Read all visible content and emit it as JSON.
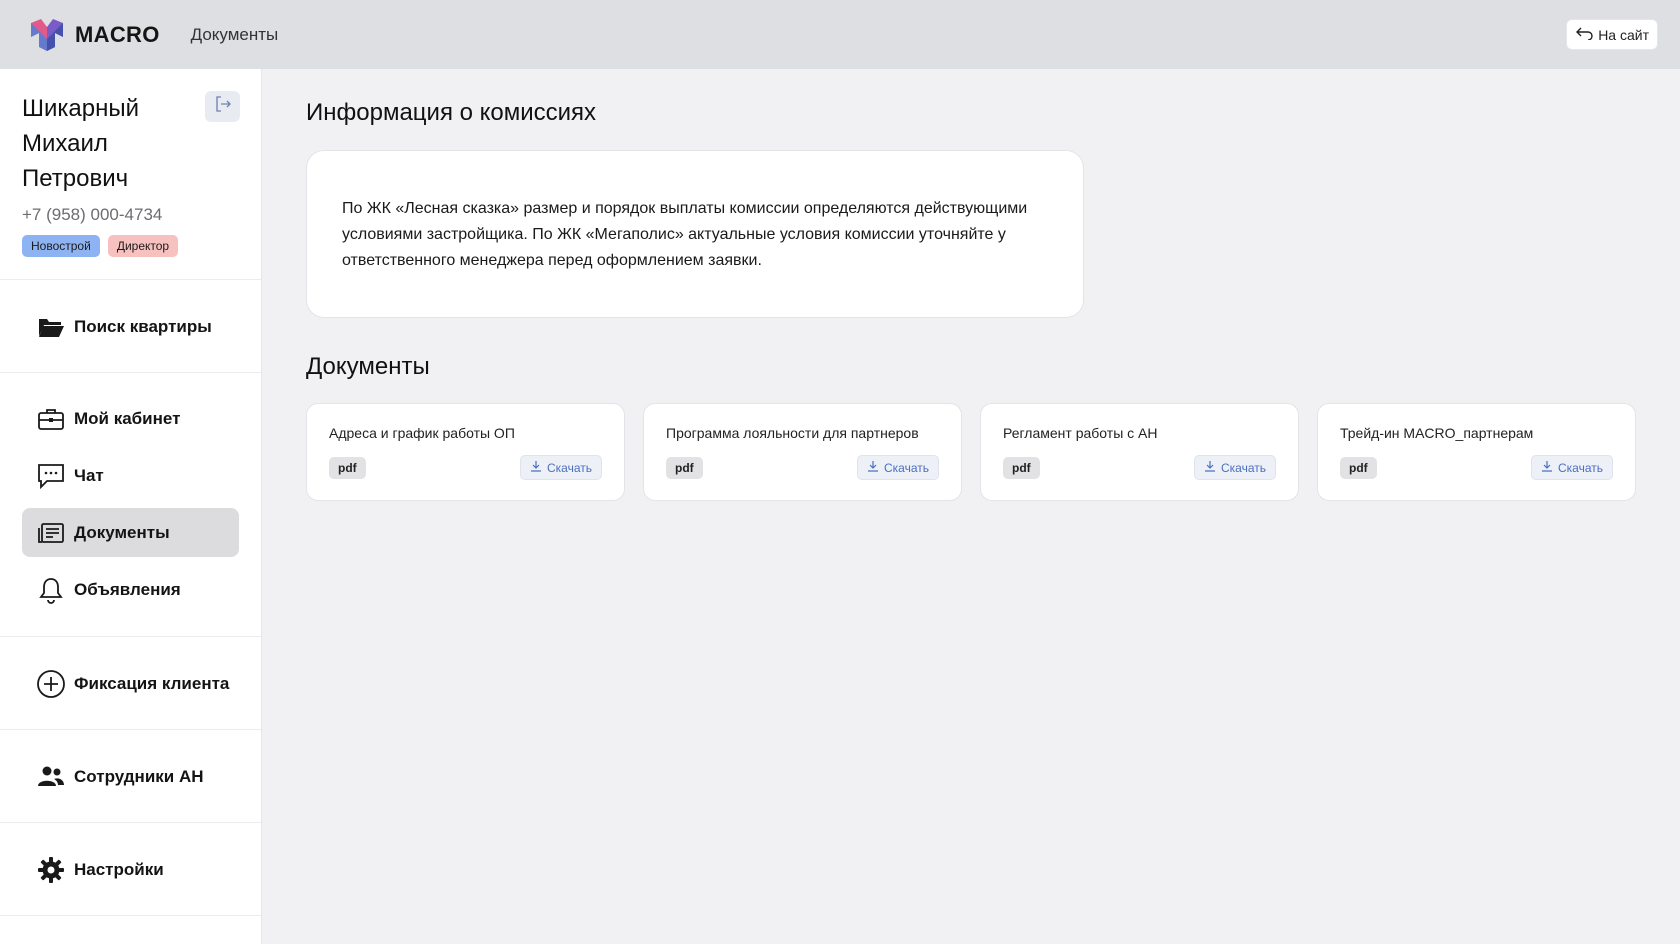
{
  "header": {
    "logo_text": "MACRO",
    "breadcrumb": "Документы",
    "to_site_label": "На сайт"
  },
  "profile": {
    "name_line1": "Шикарный",
    "name_line2": "Михаил",
    "name_line3": "Петрович",
    "phone": "+7 (958) 000-4734",
    "badges": [
      "Новострой",
      "Директор"
    ]
  },
  "nav": {
    "search": "Поиск квартиры",
    "cabinet": "Мой кабинет",
    "chat": "Чат",
    "documents": "Документы",
    "announcements": "Объявления",
    "client_fix": "Фиксация клиента",
    "staff": "Сотрудники АН",
    "settings": "Настройки"
  },
  "main": {
    "commission_title": "Информация о комиссиях",
    "commission_text": "По ЖК «Лесная сказка» размер и порядок выплаты комиссии определяются действующими условиями застройщика. По ЖК «Мегаполис» актуальные условия комиссии уточняйте у ответственного менеджера перед оформлением заявки.",
    "documents_title": "Документы",
    "documents": [
      {
        "title": "Адреса и график работы ОП",
        "type": "pdf",
        "download": "Скачать"
      },
      {
        "title": "Программа лояльности для партнеров",
        "type": "pdf",
        "download": "Скачать"
      },
      {
        "title": "Регламент работы с АН",
        "type": "pdf",
        "download": "Скачать"
      },
      {
        "title": "Трейд-ин MACRO_партнерам",
        "type": "pdf",
        "download": "Скачать"
      }
    ]
  },
  "colors": {
    "topbar": "#dedfe3",
    "badge_blue": "#8eb3f3",
    "badge_red": "#f7c1c0",
    "active_nav": "#dcdcdf",
    "download_text": "#4b6fc0"
  },
  "icons": {
    "logo": "macro-logo-icon",
    "to_site": "return-arrow-icon",
    "logout": "logout-icon",
    "search": "folder-open-icon",
    "cabinet": "briefcase-icon",
    "chat": "chat-bubble-icon",
    "documents": "document-list-icon",
    "announcements": "bell-icon",
    "client_fix": "plus-circle-icon",
    "staff": "users-icon",
    "settings": "gear-icon",
    "download": "download-icon"
  }
}
